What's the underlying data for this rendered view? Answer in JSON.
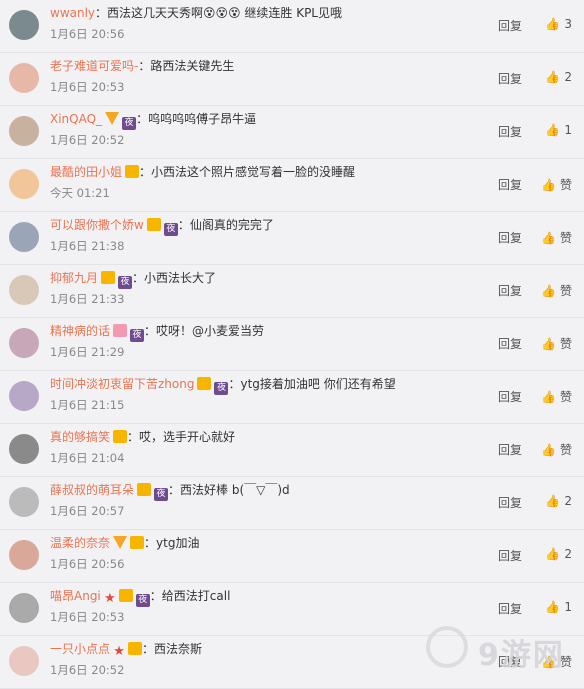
{
  "ui": {
    "reply_label": "回复",
    "like_icon": "thumbs-up-icon",
    "colors": {
      "username": "#eb7350",
      "background": "#f2f2f5"
    }
  },
  "comments": [
    {
      "user": "wwanly",
      "text": "西法这几天天秀啊😵😵😵 继续连胜 KPL见哦",
      "time": "1月6日 20:56",
      "likes": "3",
      "badges": []
    },
    {
      "user": "老子难道可爱吗-",
      "text": "路西法关键先生",
      "time": "1月6日 20:53",
      "likes": "2",
      "badges": []
    },
    {
      "user": "XinQAQ_",
      "text": "呜呜呜呜傅子昂牛逼",
      "time": "1月6日 20:52",
      "likes": "1",
      "badges": [
        "v",
        "night"
      ]
    },
    {
      "user": "最酷的田小姐",
      "text": "小西法这个照片感觉写着一脸的没睡醒",
      "time": "今天 01:21",
      "likes": "赞",
      "badges": [
        "crown"
      ]
    },
    {
      "user": "可以跟你撒个娇w",
      "text": "仙阁真的完完了",
      "time": "1月6日 21:38",
      "likes": "赞",
      "badges": [
        "crown",
        "night"
      ]
    },
    {
      "user": "抑郁九月",
      "text": "小西法长大了",
      "time": "1月6日 21:33",
      "likes": "赞",
      "badges": [
        "crown",
        "night"
      ]
    },
    {
      "user": "精神病的话",
      "text": "哎呀！@小麦爱当劳",
      "time": "1月6日 21:29",
      "likes": "赞",
      "badges": [
        "heart",
        "night"
      ]
    },
    {
      "user": "时间冲淡初衷留下苦zhong",
      "text": "ytg接着加油吧 你们还有希望",
      "time": "1月6日 21:15",
      "likes": "赞",
      "badges": [
        "crown",
        "night"
      ]
    },
    {
      "user": "真的够搞笑",
      "text": "哎，选手开心就好",
      "time": "1月6日 21:04",
      "likes": "赞",
      "badges": [
        "crown"
      ]
    },
    {
      "user": "薛叔叔的萌耳朵",
      "text": "西法好棒 b(￣▽￣)d",
      "time": "1月6日 20:57",
      "likes": "2",
      "badges": [
        "crown",
        "night"
      ]
    },
    {
      "user": "温柔的奈奈",
      "text": "ytg加油",
      "time": "1月6日 20:56",
      "likes": "2",
      "badges": [
        "v",
        "crown"
      ]
    },
    {
      "user": "喵昂Angi",
      "text": "给西法打call",
      "time": "1月6日 20:53",
      "likes": "1",
      "badges": [
        "star",
        "crown",
        "night"
      ]
    },
    {
      "user": "一只小点点",
      "text": "西法奈斯",
      "time": "1月6日 20:52",
      "likes": "赞",
      "badges": [
        "star",
        "crown"
      ]
    }
  ]
}
